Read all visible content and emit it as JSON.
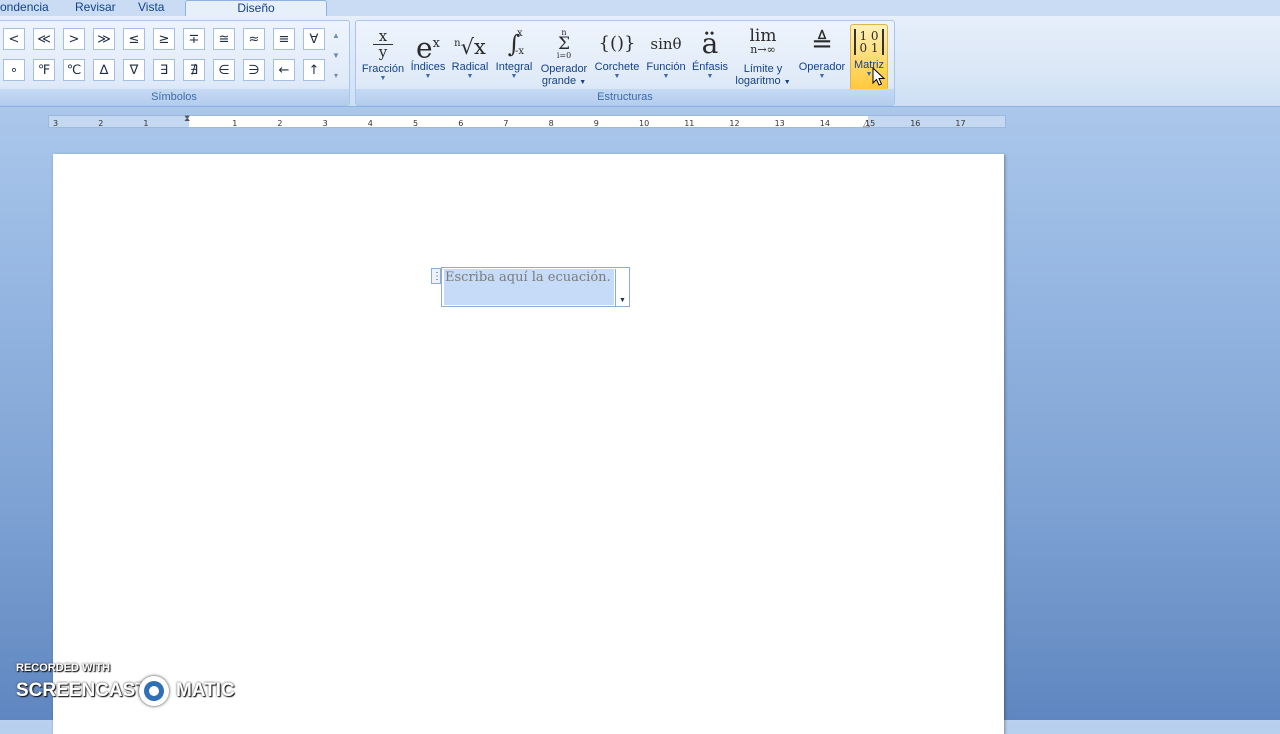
{
  "tabs": {
    "items": [
      "ondencia",
      "Revisar",
      "Vista",
      "Diseño"
    ],
    "active": "Diseño"
  },
  "symbols_group": {
    "label": "Símbolos",
    "row1": [
      "<",
      "≪",
      ">",
      "≫",
      "≤",
      "≥",
      "∓",
      "≅",
      "≈",
      "≡",
      "∀"
    ],
    "row2": [
      "∘",
      "℉",
      "℃",
      "∆",
      "∇",
      "∃",
      "∄",
      "∈",
      "∋",
      "←",
      "↑"
    ]
  },
  "structures_group": {
    "label": "Estructuras",
    "items": [
      {
        "label": "Fracción",
        "icon": "fraction-icon"
      },
      {
        "label": "Índices",
        "icon": "script-icon"
      },
      {
        "label": "Radical",
        "icon": "radical-icon"
      },
      {
        "label": "Integral",
        "icon": "integral-icon"
      },
      {
        "label": "Operador",
        "label2": "grande",
        "icon": "large-operator-icon"
      },
      {
        "label": "Corchete",
        "icon": "bracket-icon"
      },
      {
        "label": "Función",
        "icon": "function-icon"
      },
      {
        "label": "Énfasis",
        "icon": "accent-icon"
      },
      {
        "label": "Límite y",
        "label2": "logaritmo",
        "icon": "limit-icon"
      },
      {
        "label": "Operador",
        "icon": "operator-icon"
      },
      {
        "label": "Matriz",
        "icon": "matrix-icon"
      }
    ],
    "icon_text": {
      "fraction_num": "x",
      "fraction_den": "y",
      "script_base": "e",
      "script_sup": "x",
      "radical_index": "n",
      "radical_body": "√x",
      "integral_sign": "∫",
      "integral_upper": "x",
      "integral_lower": "-x",
      "sum_upper": "n",
      "sum_sign": "Σ",
      "sum_lower": "i=0",
      "bracket": "{()}",
      "function": "sinθ",
      "accent": "ä",
      "limit_top": "lim",
      "limit_bottom": "n→∞",
      "operator": "≜",
      "matrix_row1": "1 0",
      "matrix_row2": "0 1"
    }
  },
  "ruler": {
    "ticks": [
      "3",
      "2",
      "1",
      "1",
      "2",
      "3",
      "4",
      "5",
      "6",
      "7",
      "8",
      "9",
      "10",
      "11",
      "12",
      "13",
      "14",
      "15",
      "16",
      "17"
    ]
  },
  "equation": {
    "placeholder": "Escriba aquí la ecuación."
  },
  "watermark": {
    "line1": "RECORDED WITH",
    "left": "SCREENCAST",
    "right": "MATIC"
  }
}
